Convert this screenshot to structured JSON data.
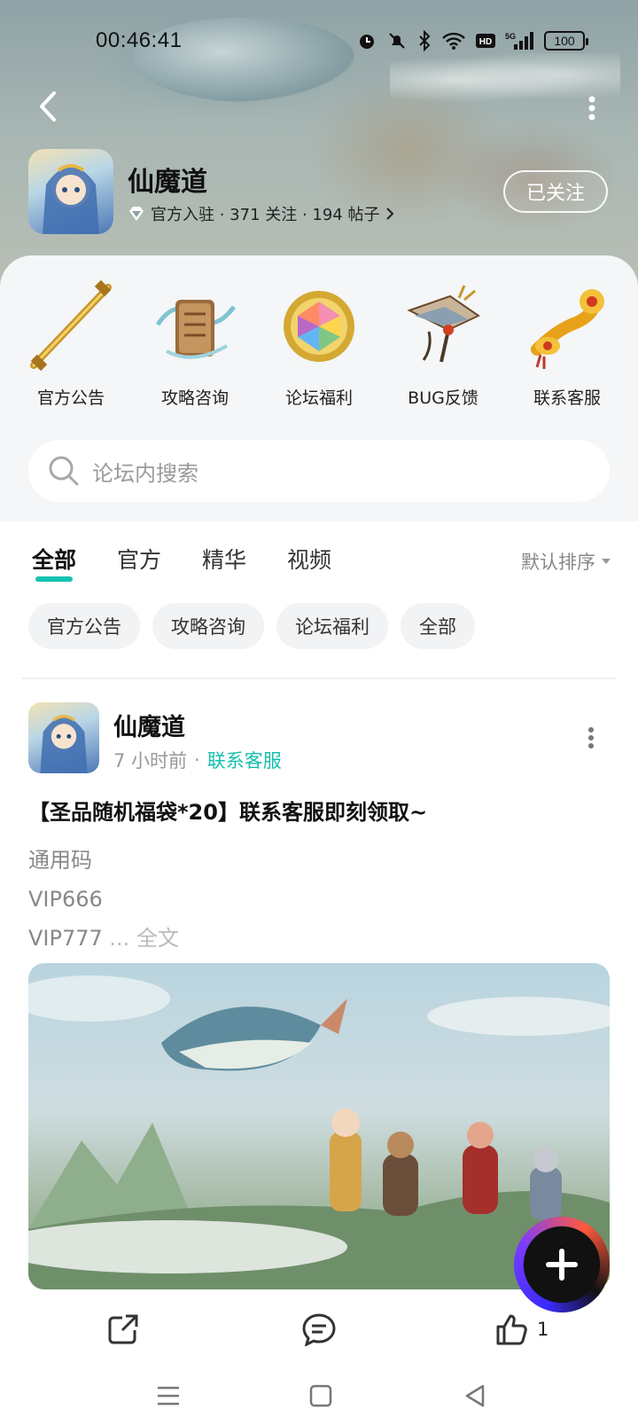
{
  "status_bar": {
    "time": "00:46:41",
    "battery": "100",
    "icons": [
      "alarm-icon",
      "mute-icon",
      "bluetooth-icon",
      "wifi-icon",
      "hd-icon",
      "signal-5g-icon"
    ]
  },
  "header": {
    "title": "仙魔道",
    "meta": "官方入驻 · 371 关注 · 194 帖子",
    "follow_label": "已关注"
  },
  "quick_links": [
    {
      "label": "官方公告",
      "icon": "golden-staff-icon"
    },
    {
      "label": "攻略咨询",
      "icon": "scroll-icon"
    },
    {
      "label": "论坛福利",
      "icon": "rainbow-gem-icon"
    },
    {
      "label": "BUG反馈",
      "icon": "bug-feedback-icon"
    },
    {
      "label": "联系客服",
      "icon": "ruyi-icon"
    }
  ],
  "search": {
    "placeholder": "论坛内搜索"
  },
  "tabs": [
    "全部",
    "官方",
    "精华",
    "视频"
  ],
  "active_tab": "全部",
  "sort_label": "默认排序",
  "chips": [
    "官方公告",
    "攻略咨询",
    "论坛福利",
    "全部"
  ],
  "post": {
    "author": "仙魔道",
    "time": "7 小时前",
    "category": "联系客服",
    "title": "【圣品随机福袋*20】联系客服即刻领取~",
    "lines": [
      "通用码",
      "VIP666",
      "VIP777"
    ],
    "ellipsis": "...",
    "fulltext_label": "全文",
    "like_count": "1"
  },
  "colors": {
    "accent": "#17c3b2",
    "category_text": "#17bfae"
  }
}
